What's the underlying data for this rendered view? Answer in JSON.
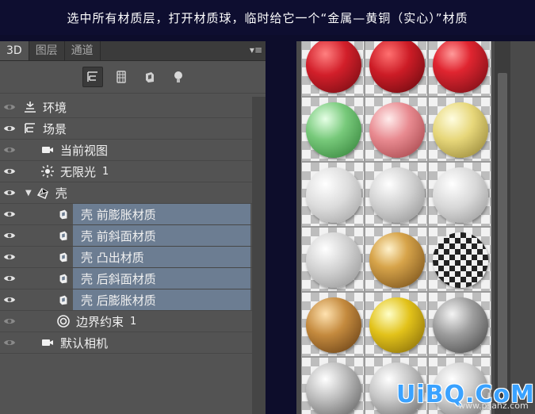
{
  "caption": "选中所有材质层，打开材质球，临时给它一个“金属—黄铜（实心）”材质",
  "panel": {
    "tabs": [
      {
        "label": "3D",
        "active": true
      },
      {
        "label": "图层",
        "active": false
      },
      {
        "label": "通道",
        "active": false
      }
    ],
    "menu_label": "▾≡",
    "filters": [
      {
        "icon": "scene-filter-icon",
        "active": true
      },
      {
        "icon": "mesh-filter-icon",
        "active": false
      },
      {
        "icon": "material-filter-icon",
        "active": false
      },
      {
        "icon": "light-filter-icon",
        "active": false
      }
    ],
    "layers": [
      {
        "label": "环境",
        "num": "",
        "icon": "environment-icon",
        "selected": false,
        "eye_dim": true
      },
      {
        "label": "场景",
        "num": "",
        "icon": "scene-icon",
        "selected": false,
        "eye_dim": false
      },
      {
        "label": "当前视图",
        "num": "",
        "icon": "camera-icon",
        "selected": false,
        "eye_dim": true
      },
      {
        "label": "无限光",
        "num": "1",
        "icon": "infinite-light-icon",
        "selected": false,
        "eye_dim": false
      },
      {
        "label": "壳",
        "num": "",
        "icon": "mesh-icon",
        "selected": false,
        "eye_dim": false
      },
      {
        "label": "壳 前膨胀材质",
        "num": "",
        "icon": "material-icon",
        "selected": true,
        "eye_dim": false
      },
      {
        "label": "壳 前斜面材质",
        "num": "",
        "icon": "material-icon",
        "selected": true,
        "eye_dim": false
      },
      {
        "label": "壳 凸出材质",
        "num": "",
        "icon": "material-icon",
        "selected": true,
        "eye_dim": false
      },
      {
        "label": "壳 后斜面材质",
        "num": "",
        "icon": "material-icon",
        "selected": true,
        "eye_dim": false
      },
      {
        "label": "壳 后膨胀材质",
        "num": "",
        "icon": "material-icon",
        "selected": true,
        "eye_dim": false
      },
      {
        "label": "边界约束",
        "num": "1",
        "icon": "constraint-icon",
        "selected": false,
        "eye_dim": true
      },
      {
        "label": "默认相机",
        "num": "",
        "icon": "camera-icon",
        "selected": false,
        "eye_dim": true
      }
    ]
  },
  "materials": [
    {
      "name": "red-fabric-a",
      "bg": "radial-gradient(circle at 35% 30%, #ff8080 0%, #d21f2a 40%, #6a0a10 100%)"
    },
    {
      "name": "red-fabric-b",
      "bg": "radial-gradient(circle at 35% 30%, #ff7070 0%, #cc1c26 40%, #5e080d 100%)"
    },
    {
      "name": "red-sparkle",
      "bg": "radial-gradient(circle at 35% 30%, #ff9a9a 0%, #e02530 35%, #6b0b12 100%)"
    },
    {
      "name": "green-glass",
      "bg": "radial-gradient(circle at 35% 30%, #e6ffe6 0%, #77c97a 40%, #2d7a33 100%)"
    },
    {
      "name": "pink-glass",
      "bg": "radial-gradient(circle at 35% 30%, #ffecec 0%, #e88a90 40%, #9a3b40 100%)"
    },
    {
      "name": "yellow-glass",
      "bg": "radial-gradient(circle at 35% 30%, #fffde0 0%, #e7d77a 40%, #8a7a2e 100%)"
    },
    {
      "name": "clear-glass-a",
      "bg": "radial-gradient(circle at 35% 30%, #ffffff 0%, #dcdcdc 45%, #9a9a9a 100%)"
    },
    {
      "name": "clear-glass-b",
      "bg": "radial-gradient(circle at 35% 30%, #ffffff 0%, #d0d0d0 45%, #8a8a8a 100%)"
    },
    {
      "name": "clear-glass-c",
      "bg": "radial-gradient(circle at 35% 30%, #ffffff 0%, #d8d8d8 45%, #909090 100%)"
    },
    {
      "name": "clear-glass-d",
      "bg": "radial-gradient(circle at 35% 30%, #ffffff 0%, #cfcfcf 45%, #8c8c8c 100%)"
    },
    {
      "name": "gold-metal",
      "bg": "radial-gradient(circle at 35% 30%, #fff2cc 0%, #d7a44a 35%, #6b4514 100%)"
    },
    {
      "name": "checker-chrome",
      "bg": "repeating-conic-gradient(#222 0% 25%, #f0f0f0 0% 50%) 0 0/14px 14px"
    },
    {
      "name": "brass-solid",
      "bg": "radial-gradient(circle at 35% 30%, #ffe2b0 0%, #c48a3e 40%, #5a3510 100%)"
    },
    {
      "name": "yellow-metal",
      "bg": "radial-gradient(circle at 35% 30%, #ffffc8 0%, #e2c21a 40%, #7a6008 100%)"
    },
    {
      "name": "grey-metal",
      "bg": "radial-gradient(circle at 35% 30%, #f4f4f4 0%, #9d9d9d 40%, #3e3e3e 100%)"
    },
    {
      "name": "brushed-steel",
      "bg": "radial-gradient(circle at 35% 30%, #ffffff 0%, #bdbdbd 40%, #555555 100%)"
    },
    {
      "name": "silver-metal",
      "bg": "radial-gradient(circle at 35% 30%, #ffffff 0%, #c7c7c7 40%, #5e5e5e 100%)"
    },
    {
      "name": "chrome-metal",
      "bg": "radial-gradient(circle at 35% 30%, #ffffff 0%, #d0d0d0 40%, #666666 100%)"
    }
  ],
  "watermark": {
    "brand": "UiBQ.CoM",
    "url": "www.psahz.com"
  }
}
